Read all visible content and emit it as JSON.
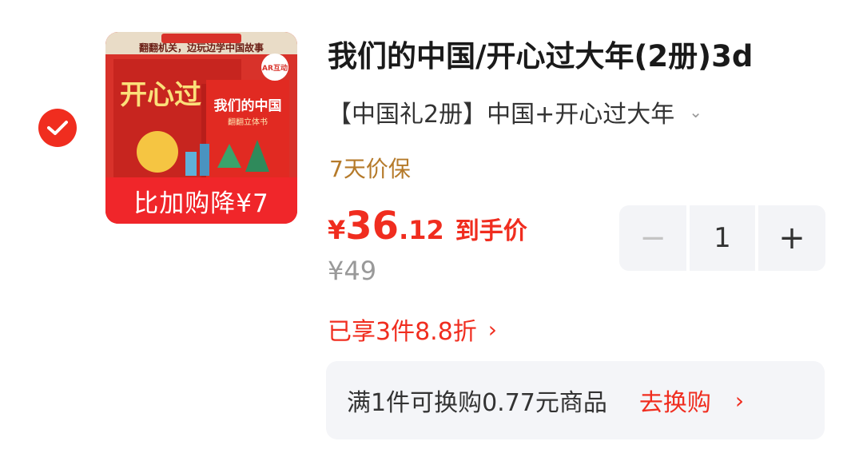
{
  "item": {
    "selected": true,
    "thumbnail": {
      "banner_text": "比加购降¥7",
      "cover_top_text": "翻翻机关，边玩边学中国故事",
      "cover_title": "开心过大年",
      "book_title": "我们的中国",
      "book_subtitle": "翻翻立体书",
      "ar_badge": "AR互动"
    },
    "title": "我们的中国/开心过大年(2册)3d",
    "variant": "【中国礼2册】中国+开心过大年",
    "guarantee": "7天价保",
    "price": {
      "symbol": "¥",
      "integer": "36",
      "decimal": ".12",
      "suffix": "到手价"
    },
    "original_price": "¥49",
    "discount_text": "已享3件8.8折",
    "quantity": {
      "minus": "−",
      "value": "1",
      "plus": "+"
    },
    "exchange": {
      "text": "满1件可换购0.77元商品",
      "link": "去换购"
    }
  },
  "colors": {
    "accent": "#f02d1f",
    "guarantee": "#b57a2a",
    "muted": "#999999"
  }
}
